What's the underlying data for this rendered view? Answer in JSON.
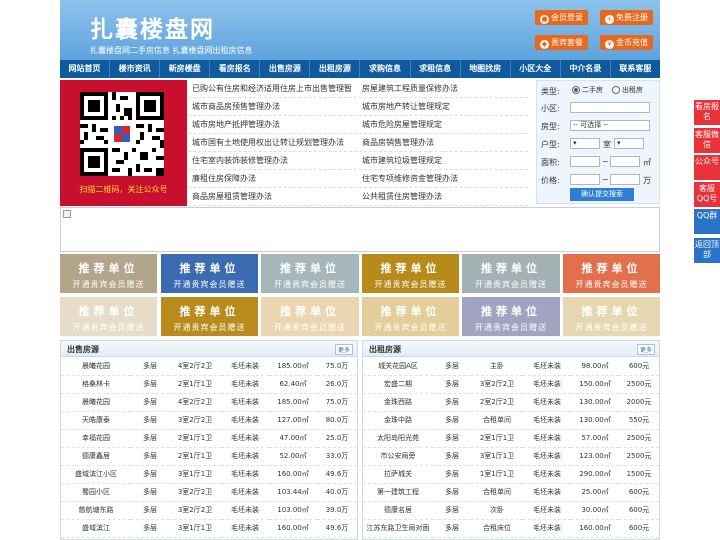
{
  "header": {
    "logo": "扎囊楼盘网",
    "slogan": "扎囊楼盘网二手房信息    扎囊楼盘网出租房信息",
    "buttons": [
      {
        "label": "会员登录",
        "icon": "user-icon"
      },
      {
        "label": "免费注册",
        "icon": "person-add-icon"
      },
      {
        "label": "贵宾套餐",
        "icon": "gift-icon"
      },
      {
        "label": "金币充值",
        "icon": "coin-icon"
      }
    ]
  },
  "nav": [
    "网站首页",
    "楼市资讯",
    "新房楼盘",
    "看房报名",
    "出售房源",
    "出租房源",
    "求购信息",
    "求租信息",
    "地图找房",
    "小区大全",
    "中介名录",
    "联系客服"
  ],
  "qr": {
    "caption": "扫描二维码，关注公众号"
  },
  "links": [
    [
      "已购公有住房和经济适用住房上市出售管理暂",
      "房屋建筑工程质量保修办法"
    ],
    [
      "城市商品房预售管理办法",
      "城市房地产转让管理规定"
    ],
    [
      "城市房地产抵押管理办法",
      "城市危险房屋管理规定"
    ],
    [
      "城市国有土地使用权出让转让规划管理办法",
      "商品房销售管理办法"
    ],
    [
      "住宅室内装饰装修管理办法",
      "城市建筑垃圾管理规定"
    ],
    [
      "廉租住房保障办法",
      "住宅专项维修资金管理办法"
    ],
    [
      "商品房屋租赁管理办法",
      "公共租赁住房管理办法"
    ]
  ],
  "search": {
    "type_label": "类型:",
    "type_options": [
      "二手房",
      "出租房"
    ],
    "type_selected": "二手房",
    "community_label": "小区:",
    "house_label": "房型:",
    "house_select": "-- 可选择 --",
    "layout_label": "户型:",
    "layout_room": "室",
    "area_label": "面积:",
    "area_unit": "㎡",
    "price_label": "价格:",
    "price_unit": "万",
    "submit": "确认提交搜索"
  },
  "side": [
    "看房报名",
    "客服微信",
    "公众号",
    "客服QQ号",
    "QQ群",
    "返回顶部"
  ],
  "recommend": {
    "title": "推荐单位",
    "subtitle": "开通贵宾会员赠送",
    "colors": [
      "#b3a58a",
      "#3b6bb1",
      "#a6b6ba",
      "#b88a19",
      "#a4b1b4",
      "#e36f4b",
      "#e7dcc7",
      "#b98b1d",
      "#ead7b2",
      "#e3cd98",
      "#a2a3c0",
      "#e5d8b0"
    ]
  },
  "sale": {
    "title": "出售房源",
    "more": "更多",
    "rows": [
      [
        "晨曦花园",
        "多层",
        "4室2厅2卫",
        "毛坯未装",
        "185.00㎡",
        "75.0万"
      ],
      [
        "格桑林卡",
        "多层",
        "2室1厅1卫",
        "毛坯未装",
        "62.40㎡",
        "26.0万"
      ],
      [
        "晨曦花园",
        "多层",
        "4室2厅2卫",
        "毛坯未装",
        "185.00㎡",
        "75.0万"
      ],
      [
        "天皓康泰",
        "多层",
        "3室2厅2卫",
        "毛坯未装",
        "127.00㎡",
        "80.0万"
      ],
      [
        "幸福花园",
        "多层",
        "2室1厅1卫",
        "毛坯未装",
        "47.00㎡",
        "25.0万"
      ],
      [
        "德康鑫居",
        "多层",
        "2室1厅1卫",
        "毛坯未装",
        "52.00㎡",
        "33.0万"
      ],
      [
        "盛域滨江小区",
        "多层",
        "3室1厅1卫",
        "毛坯未装",
        "160.00㎡",
        "49.6万"
      ],
      [
        "蜀园小区",
        "多层",
        "3室2厅2卫",
        "毛坯未装",
        "103.44㎡",
        "40.0万"
      ],
      [
        "慈航塘东路",
        "多层",
        "3室2厅2卫",
        "毛坯未装",
        "103.00㎡",
        "39.0万"
      ],
      [
        "盛域滨江",
        "多层",
        "3室1厅1卫",
        "毛坯未装",
        "160.00㎡",
        "49.6万"
      ]
    ]
  },
  "rent": {
    "title": "出租房源",
    "more": "更多",
    "rows": [
      [
        "城关花园A区",
        "多层",
        "主卧",
        "毛坯未装",
        "98.00㎡",
        "600元"
      ],
      [
        "宏盛二期",
        "多层",
        "3室2厅2卫",
        "毛坯未装",
        "150.00㎡",
        "2500元"
      ],
      [
        "金珠西路",
        "多层",
        "2室2厅2卫",
        "毛坯未装",
        "130.00㎡",
        "2000元"
      ],
      [
        "金珠中路",
        "多层",
        "合租单间",
        "毛坯未装",
        "130.00㎡",
        "550元"
      ],
      [
        "太阳岛阳光苑",
        "多层",
        "2室1厅1卫",
        "毛坯未装",
        "57.00㎡",
        "2500元"
      ],
      [
        "市公安局旁",
        "多层",
        "3室1厅1卫",
        "毛坯未装",
        "123.00㎡",
        "2500元"
      ],
      [
        "拉萨城关",
        "多层",
        "1室1厅1卫",
        "毛坯未装",
        "290.00㎡",
        "1500元"
      ],
      [
        "第一建筑工程",
        "多层",
        "合租单间",
        "毛坯未装",
        "25.00㎡",
        "600元"
      ],
      [
        "德康名居",
        "多层",
        "次卧",
        "毛坯未装",
        "30.00㎡",
        "600元"
      ],
      [
        "江苏东路卫生局对面",
        "多层",
        "合租床位",
        "毛坯未装",
        "160.00㎡",
        "600元"
      ]
    ]
  }
}
